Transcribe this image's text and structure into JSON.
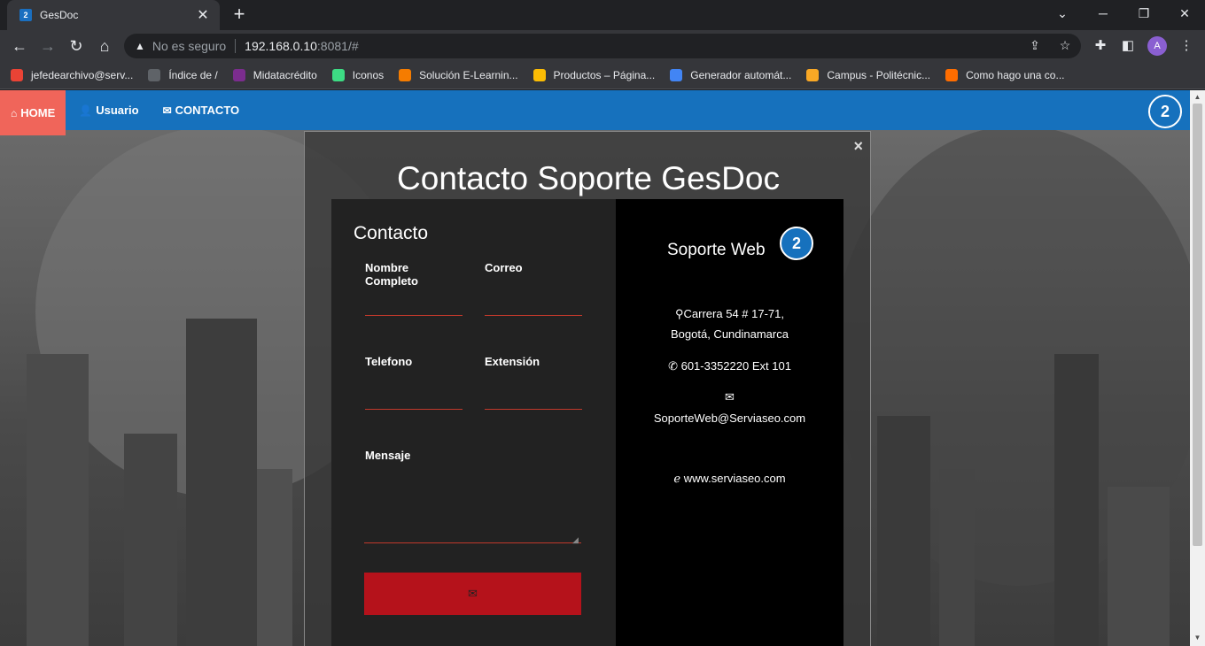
{
  "browser": {
    "tab_title": "GesDoc",
    "tab_close": "✕",
    "new_tab": "+",
    "insecure_label": "No es seguro",
    "url_host": "192.168.0.10",
    "url_rest": ":8081/#",
    "avatar_letter": "A"
  },
  "bookmarks": [
    {
      "label": "jefedearchivo@serv...",
      "color": "#ea4335"
    },
    {
      "label": "Índice de /",
      "color": "#5f6368"
    },
    {
      "label": "Midatacrédito",
      "color": "#7b2d8e"
    },
    {
      "label": "Iconos",
      "color": "#3ddc84"
    },
    {
      "label": "Solución E-Learnin...",
      "color": "#f57c00"
    },
    {
      "label": "Productos – Página...",
      "color": "#fbbc04"
    },
    {
      "label": "Generador automát...",
      "color": "#4285f4"
    },
    {
      "label": "Campus - Politécnic...",
      "color": "#f9a825"
    },
    {
      "label": "Como hago una co...",
      "color": "#ff6d00"
    }
  ],
  "navbar": {
    "home": "HOME",
    "usuario": "Usuario",
    "contacto": "CONTACTO"
  },
  "modal": {
    "title": "Contacto Soporte GesDoc",
    "close": "×",
    "form": {
      "heading": "Contacto",
      "name_label": "Nombre Completo",
      "email_label": "Correo",
      "phone_label": "Telefono",
      "ext_label": "Extensión",
      "message_label": "Mensaje",
      "submit_icon": "✉"
    },
    "info": {
      "title": "Soporte Web",
      "address_line1": "Carrera 54 # 17-71,",
      "address_line2": "Bogotá, Cundinamarca",
      "phone": "601-3352220 Ext 101",
      "email": "SoporteWeb@Serviaseo.com",
      "website": "www.serviaseo.com"
    }
  },
  "colors": {
    "navbar": "#1671bd",
    "home_active": "#f0655a",
    "submit": "#b5121b",
    "input_underline": "#c0392b"
  }
}
